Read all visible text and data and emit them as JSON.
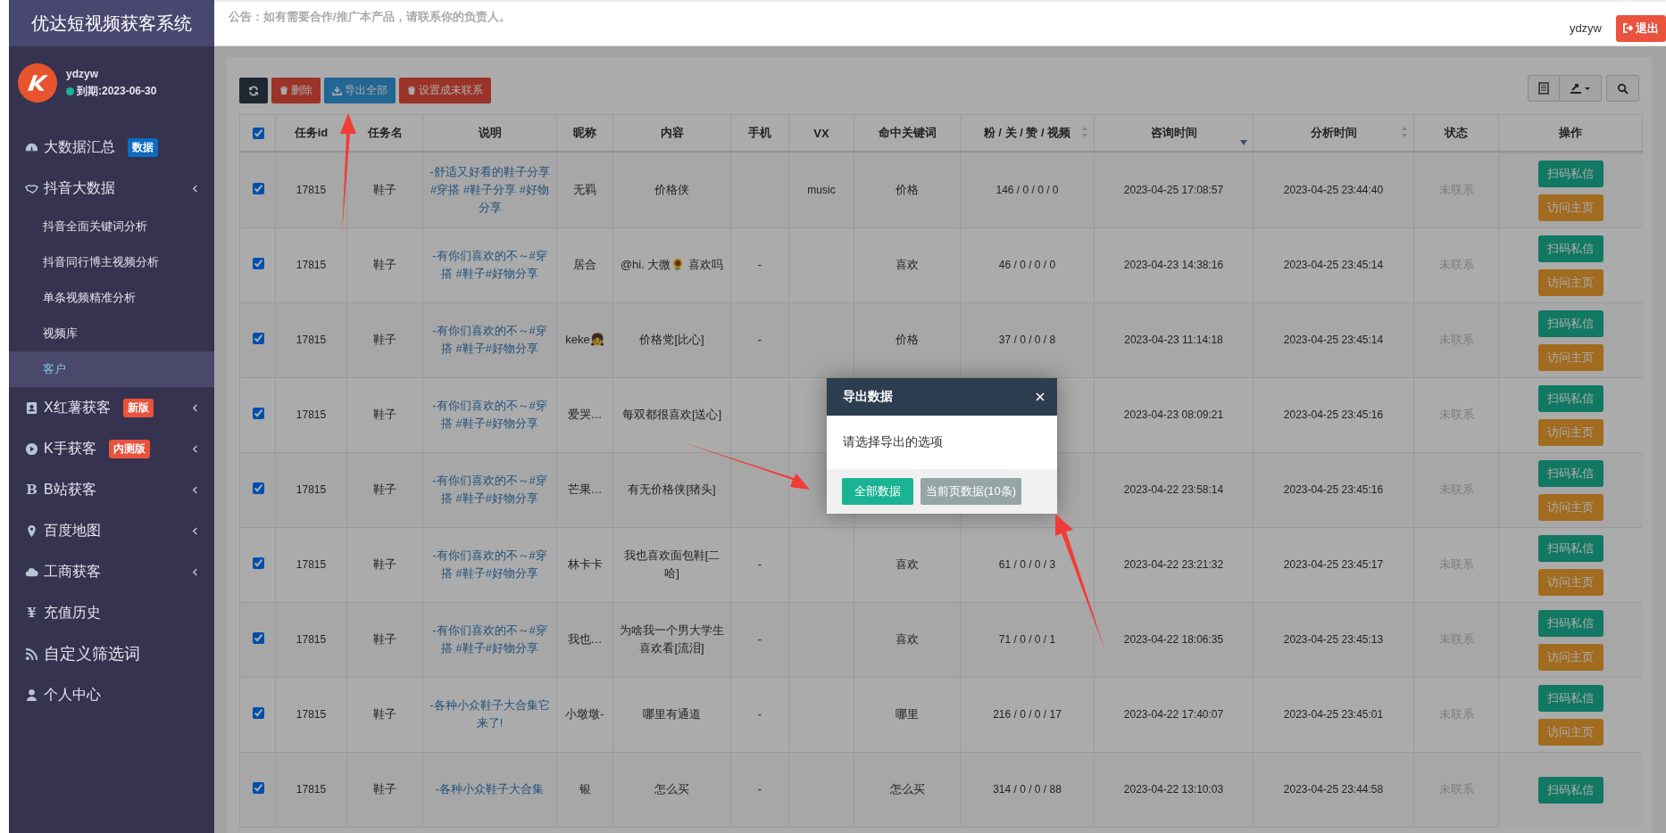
{
  "sidebar": {
    "brand": "优达短视频获客系统",
    "user": {
      "name": "ydzyw",
      "expiry": "到期:2023-06-30",
      "online": true
    },
    "items": [
      {
        "label": "大数据汇总",
        "submenu": false,
        "badge": {
          "text": "数据",
          "color": "#0d6bc2"
        }
      },
      {
        "label": "抖音大数据",
        "submenu": true,
        "children": [
          {
            "label": "抖音全面关键词分析",
            "selected": false
          },
          {
            "label": "抖音同行博主视频分析",
            "selected": false
          },
          {
            "label": "单条视频精准分析",
            "selected": false
          },
          {
            "label": "视频库",
            "selected": false
          },
          {
            "label": "客户",
            "selected": true
          }
        ]
      },
      {
        "label": "X红薯获客",
        "submenu": true,
        "badge": {
          "text": "新版",
          "color": "#e9523c"
        }
      },
      {
        "label": "K手获客",
        "submenu": true,
        "badge": {
          "text": "内测版",
          "color": "#e9523c"
        }
      },
      {
        "label": "B站获客",
        "glyph": "B",
        "submenu": true
      },
      {
        "label": "百度地图",
        "submenu": true
      },
      {
        "label": "工商获客",
        "submenu": true
      },
      {
        "label": "充值历史",
        "glyph": "¥",
        "submenu": false
      },
      {
        "label": "自定义筛选词",
        "submenu": false
      },
      {
        "label": "个人中心",
        "submenu": false
      }
    ]
  },
  "header": {
    "notice": "公告：如有需要合作/推广本产品，请联系你的负责人。",
    "username": "ydzyw",
    "logout": "退出"
  },
  "toolbar": {
    "buttons": [
      {
        "kind": "refresh"
      },
      {
        "kind": "danger",
        "label": "删除"
      },
      {
        "kind": "export",
        "label": "导出全部"
      },
      {
        "kind": "danger",
        "label": "设置成未联系"
      }
    ]
  },
  "table": {
    "all_checked": true,
    "columns": [
      {
        "label": "任务id",
        "sortable": false
      },
      {
        "label": "任务名",
        "sortable": false
      },
      {
        "label": "说明",
        "sortable": false
      },
      {
        "label": "昵称",
        "sortable": false
      },
      {
        "label": "内容",
        "sortable": false
      },
      {
        "label": "手机",
        "sortable": false
      },
      {
        "label": "VX",
        "sortable": false
      },
      {
        "label": "命中关键词",
        "sortable": false
      },
      {
        "label": "粉 / 关 / 赞 / 视频",
        "sortable": true,
        "sorted_desc": false
      },
      {
        "label": "咨询时间",
        "sortable": true,
        "sorted_desc": true
      },
      {
        "label": "分析时间",
        "sortable": true,
        "sorted_desc": false
      },
      {
        "label": "状态",
        "sortable": false
      },
      {
        "label": "操作",
        "sortable": false
      }
    ],
    "rows": [
      {
        "checked": true,
        "id": "17815",
        "task": "鞋子",
        "desc": "-舒适又好看的鞋子分享#穿搭 #鞋子分享 #好物分享",
        "nick": "无羁",
        "content": "价格侠",
        "vx": "music",
        "keyword": "价格",
        "stats": "146 / 0 / 0 / 0",
        "consulted": "2023-04-25 17:08:57",
        "analyzed": "2023-04-25 23:44:40",
        "status": "未联系",
        "actions": [
          "扫码私信",
          "访问主页"
        ]
      },
      {
        "checked": true,
        "id": "17815",
        "task": "鞋子",
        "desc": "-有你们喜欢的不～#穿搭 #鞋子#好物分享",
        "nick": "居合",
        "content": "@hi. 大微🌻 喜欢吗",
        "phone": "-",
        "keyword": "喜欢",
        "stats": "46 / 0 / 0 / 0",
        "consulted": "2023-04-23 14:38:16",
        "analyzed": "2023-04-25 23:45:14",
        "status": "未联系",
        "actions": [
          "扫码私信",
          "访问主页"
        ]
      },
      {
        "checked": true,
        "id": "17815",
        "task": "鞋子",
        "desc": "-有你们喜欢的不～#穿搭 #鞋子#好物分享",
        "nick": "keke👧",
        "content": "价格党[比心]",
        "phone": "-",
        "keyword": "价格",
        "stats": "37 / 0 / 0 / 8",
        "consulted": "2023-04-23 11:14:18",
        "analyzed": "2023-04-25 23:45:14",
        "status": "未联系",
        "actions": [
          "扫码私信",
          "访问主页"
        ]
      },
      {
        "checked": true,
        "id": "17815",
        "task": "鞋子",
        "desc": "-有你们喜欢的不～#穿搭 #鞋子#好物分享",
        "nick": "爱哭…",
        "content": "每双都很喜欢[送心]",
        "consulted": "2023-04-23 08:09:21",
        "analyzed": "2023-04-25 23:45:16",
        "status": "未联系",
        "actions": [
          "扫码私信",
          "访问主页"
        ]
      },
      {
        "checked": true,
        "id": "17815",
        "task": "鞋子",
        "desc": "-有你们喜欢的不～#穿搭 #鞋子#好物分享",
        "nick": "芒果…",
        "content": "有无价格侠[猪头]",
        "consulted": "2023-04-22 23:58:14",
        "analyzed": "2023-04-25 23:45:16",
        "status": "未联系",
        "actions": [
          "扫码私信",
          "访问主页"
        ]
      },
      {
        "checked": true,
        "id": "17815",
        "task": "鞋子",
        "desc": "-有你们喜欢的不～#穿搭 #鞋子#好物分享",
        "nick": "林卡卡",
        "content": "我也喜欢面包鞋[二哈]",
        "phone": "-",
        "keyword": "喜欢",
        "stats": "61 / 0 / 0 / 3",
        "consulted": "2023-04-22 23:21:32",
        "analyzed": "2023-04-25 23:45:17",
        "status": "未联系",
        "actions": [
          "扫码私信",
          "访问主页"
        ]
      },
      {
        "checked": true,
        "id": "17815",
        "task": "鞋子",
        "desc": "-有你们喜欢的不～#穿搭 #鞋子#好物分享",
        "nick": "我也…",
        "content": "为啥我一个男大学生喜欢看[流泪]",
        "phone": "-",
        "keyword": "喜欢",
        "stats": "71 / 0 / 0 / 1",
        "consulted": "2023-04-22 18:06:35",
        "analyzed": "2023-04-25 23:45:13",
        "status": "未联系",
        "actions": [
          "扫码私信",
          "访问主页"
        ]
      },
      {
        "checked": true,
        "id": "17815",
        "task": "鞋子",
        "desc": "-各种小众鞋子大合集它来了!",
        "nick": "小墩墩-",
        "content": "哪里有通道",
        "phone": "-",
        "keyword": "哪里",
        "stats": "216 / 0 / 0 / 17",
        "consulted": "2023-04-22 17:40:07",
        "analyzed": "2023-04-25 23:45:01",
        "status": "未联系",
        "actions": [
          "扫码私信",
          "访问主页"
        ]
      },
      {
        "checked": true,
        "id": "17815",
        "task": "鞋子",
        "desc": "-各种小众鞋子大合集",
        "nick": "银",
        "content": "怎么买",
        "phone": "-",
        "keyword": "怎么买",
        "stats": "314 / 0 / 0 / 88",
        "consulted": "2023-04-22 13:10:03",
        "analyzed": "2023-04-25 23:44:58",
        "status": "未联系",
        "actions": [
          "扫码私信"
        ]
      }
    ]
  },
  "modal": {
    "title": "导出数据",
    "message": "请选择导出的选项",
    "buttons": [
      {
        "kind": "primary",
        "label": "全部数据"
      },
      {
        "kind": "secondary",
        "label": "当前页数据(10条)"
      }
    ]
  }
}
